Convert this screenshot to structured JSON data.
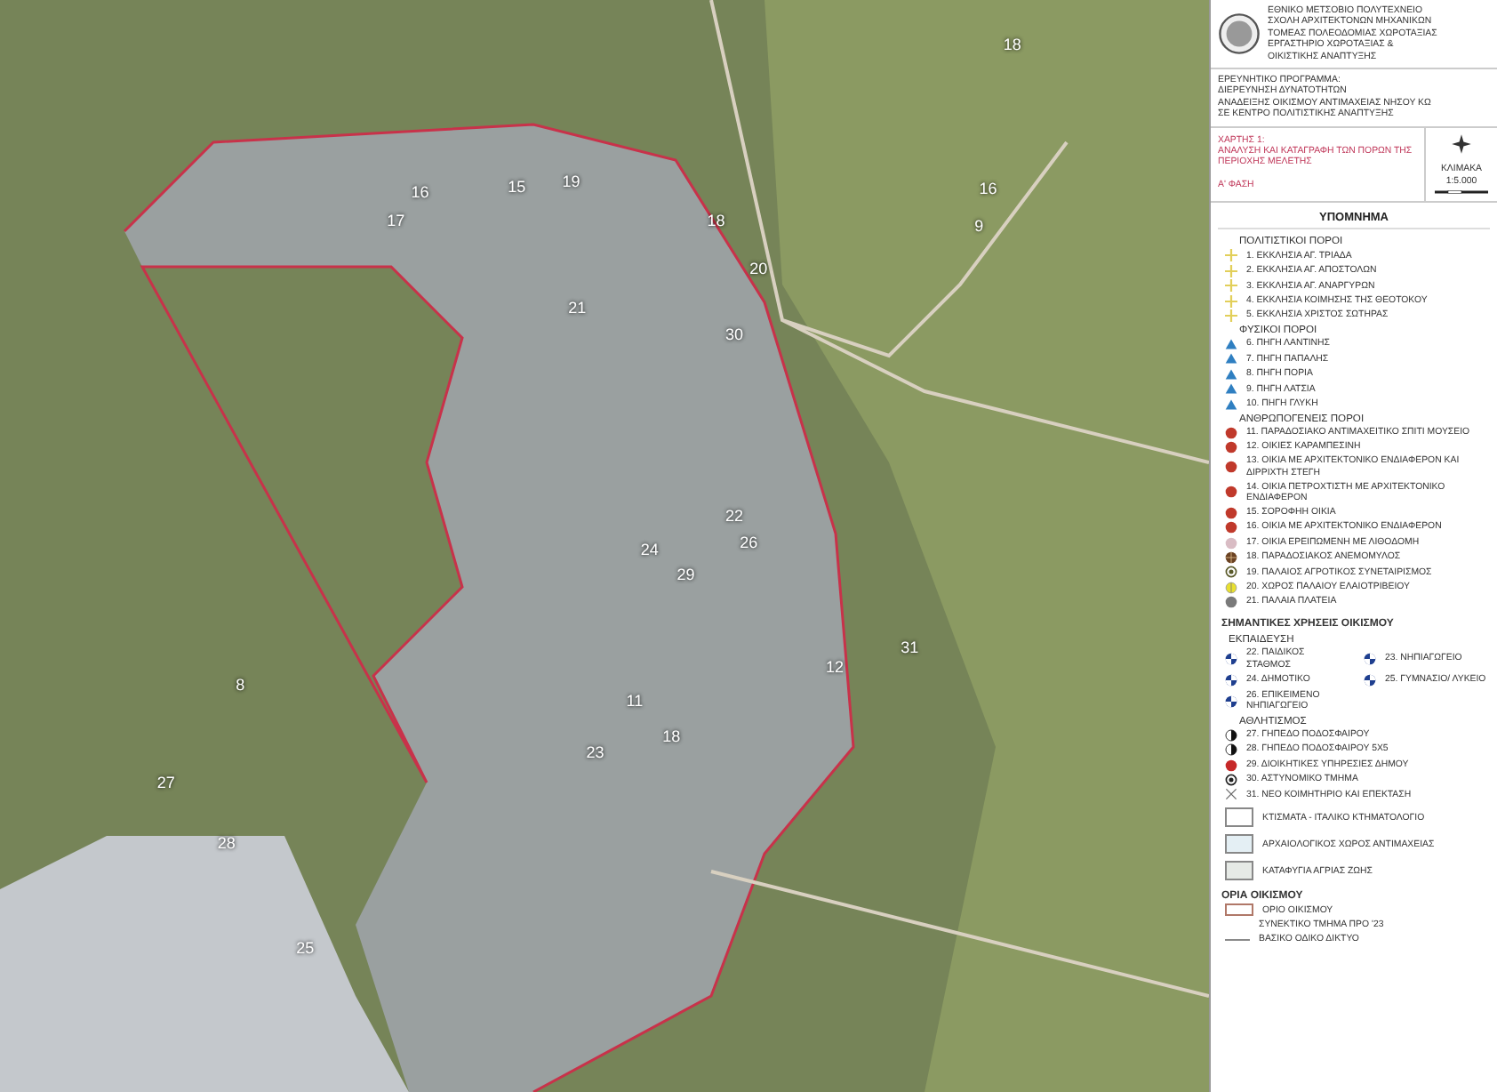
{
  "map": {
    "labels": [
      {
        "text": "16"
      },
      {
        "text": "17"
      },
      {
        "text": "15"
      },
      {
        "text": "19"
      },
      {
        "text": "18"
      },
      {
        "text": "20"
      },
      {
        "text": "30"
      },
      {
        "text": "21"
      },
      {
        "text": "22"
      },
      {
        "text": "26"
      },
      {
        "text": "29"
      },
      {
        "text": "24"
      },
      {
        "text": "12"
      },
      {
        "text": "31"
      },
      {
        "text": "11"
      },
      {
        "text": "23"
      },
      {
        "text": "18"
      },
      {
        "text": "8"
      },
      {
        "text": "27"
      },
      {
        "text": "28"
      },
      {
        "text": "25"
      },
      {
        "text": "16"
      },
      {
        "text": "9"
      },
      {
        "text": "18"
      }
    ]
  },
  "header": {
    "institution": [
      "ΕΘΝΙΚΟ ΜΕΤΣΟΒΙΟ ΠΟΛΥΤΕΧΝΕΙΟ",
      "ΣΧΟΛΗ ΑΡΧΙΤΕΚΤΟΝΩΝ ΜΗΧΑΝΙΚΩΝ",
      "ΤΟΜΕΑΣ ΠΟΛΕΟΔΟΜΙΑΣ ΧΩΡΟΤΑΞΙΑΣ",
      "ΕΡΓΑΣΤΗΡΙΟ ΧΩΡΟΤΑΞΙΑΣ &",
      "ΟΙΚΙΣΤΙΚΗΣ ΑΝΑΠΤΥΞΗΣ"
    ],
    "program": [
      "ΕΡΕΥΝΗΤΙΚΟ ΠΡΟΓΡΑΜΜΑ:",
      "ΔΙΕΡΕΥΝΗΣΗ ΔΥΝΑΤΟΤΗΤΩΝ",
      "ΑΝΑΔΕΙΞΗΣ ΟΙΚΙΣΜΟΥ ΑΝΤΙΜΑΧΕΙΑΣ ΝΗΣΟΥ ΚΩ",
      "ΣΕ ΚΕΝΤΡΟ ΠΟΛΙΤΙΣΤΙΚΗΣ ΑΝΑΠΤΥΞΗΣ"
    ],
    "map_number": "ΧΑΡΤΗΣ 1:",
    "map_title": "ΑΝΑΛΥΣΗ ΚΑΙ ΚΑΤΑΓΡΑΦΗ ΤΩΝ ΠΟΡΩΝ ΤΗΣ ΠΕΡΙΟΧΗΣ ΜΕΛΕΤΗΣ",
    "phase": "Α' ΦΑΣΗ",
    "scale_label": "ΚΛΙΜΑΚΑ",
    "scale": "1:5.000"
  },
  "legend": {
    "title": "ΥΠΟΜΝΗΜΑ",
    "groups": [
      {
        "kind": "sub",
        "title": "ΠΟΛΙΤΙΣΤΙΚΟΙ ΠΟΡΟΙ",
        "items": [
          {
            "kind": "cross",
            "color": "#e2cf5a",
            "label": "1. ΕΚΚΛΗΣΙΑ ΑΓ. ΤΡΙΑΔΑ"
          },
          {
            "kind": "cross",
            "color": "#e2cf5a",
            "label": "2. ΕΚΚΛΗΣΙΑ ΑΓ. ΑΠΟΣΤΟΛΩΝ"
          },
          {
            "kind": "cross",
            "color": "#e2cf5a",
            "label": "3. ΕΚΚΛΗΣΙΑ ΑΓ. ΑΝΑΡΓΥΡΩΝ"
          },
          {
            "kind": "cross",
            "color": "#e2cf5a",
            "label": "4. ΕΚΚΛΗΣΙΑ ΚΟΙΜΗΣΗΣ ΤΗΣ ΘΕΟΤΟΚΟΥ"
          },
          {
            "kind": "cross",
            "color": "#e2cf5a",
            "label": "5. ΕΚΚΛΗΣΙΑ ΧΡΙΣΤΟΣ ΣΩΤΗΡΑΣ"
          }
        ]
      },
      {
        "kind": "sub",
        "title": "ΦΥΣΙΚΟΙ ΠΟΡΟΙ",
        "items": [
          {
            "kind": "triangle",
            "color": "#2f7fc1",
            "label": "6. ΠΗΓΗ ΛΑΝΤΙΝΗΣ"
          },
          {
            "kind": "triangle",
            "color": "#2f7fc1",
            "label": "7. ΠΗΓΗ ΠΑΠΑΛΗΣ"
          },
          {
            "kind": "triangle",
            "color": "#2f7fc1",
            "label": "8. ΠΗΓΗ ΠΟΡΙΑ"
          },
          {
            "kind": "triangle",
            "color": "#2f7fc1",
            "label": "9. ΠΗΓΗ ΛΑΤΣΙΑ"
          },
          {
            "kind": "triangle",
            "color": "#2f7fc1",
            "label": "10. ΠΗΓΗ ΓΛΥΚΗ"
          }
        ]
      },
      {
        "kind": "sub",
        "title": "ΑΝΘΡΩΠΟΓΕΝΕΙΣ ΠΟΡΟΙ",
        "items": [
          {
            "kind": "dot",
            "color": "#c0392b",
            "label": "11. ΠΑΡΑΔΟΣΙΑΚΟ ΑΝΤΙΜΑΧΕΙΤΙΚΟ ΣΠΙΤΙ ΜΟΥΣΕΙΟ"
          },
          {
            "kind": "dot",
            "color": "#c0392b",
            "label": "12. ΟΙΚΙΕΣ ΚΑΡΑΜΠΕΣΙΝΗ"
          },
          {
            "kind": "dot",
            "color": "#c0392b",
            "label": "13. ΟΙΚΙΑ ΜΕ ΑΡΧΙΤΕΚΤΟΝΙΚΟ ΕΝΔΙΑΦΕΡΟΝ ΚΑΙ ΔΙΡΡΙΧΤΗ ΣΤΕΓΗ"
          },
          {
            "kind": "dot",
            "color": "#c0392b",
            "label": "14. ΟΙΚΙΑ ΠΕΤΡΟΧΤΙΣΤΗ ΜΕ ΑΡΧΙΤΕΚΤΟΝΙΚΟ ΕΝΔΙΑΦΕΡΟΝ"
          },
          {
            "kind": "dot",
            "color": "#c0392b",
            "label": "15. ΣΟΡΟΦΗΗ ΟΙΚΙΑ"
          },
          {
            "kind": "dot",
            "color": "#c0392b",
            "label": "16. ΟΙΚΙΑ ΜΕ ΑΡΧΙΤΕΚΤΟΝΙΚΟ ΕΝΔΙΑΦΕΡΟΝ"
          },
          {
            "kind": "dot",
            "color": "#d9bcc4",
            "label": "17. ΟΙΚΙΑ ΕΡΕΙΠΩΜΕΝΗ ΜΕ ΛΙΘΟΔΟΜΗ"
          },
          {
            "kind": "grid",
            "color": "#6b4222",
            "label": "18. ΠΑΡΑΔΟΣΙΑΚΟΣ ΑΝΕΜΟΜΥΛΟΣ"
          },
          {
            "kind": "target",
            "color": "#5a5a2a",
            "label": "19. ΠΑΛΑΙΟΣ ΑΓΡΟΤΙΚΟΣ ΣΥΝΕΤΑΙΡΙΣΜΟΣ"
          },
          {
            "kind": "ring",
            "color": "#e8e030",
            "label": "20. ΧΩΡΟΣ ΠΑΛΑΙΟΥ ΕΛΑΙΟΤΡΙΒΕΙΟΥ"
          },
          {
            "kind": "dot",
            "color": "#7a7a7a",
            "label": "21. ΠΑΛΑΙΑ ΠΛΑΤΕΙΑ"
          }
        ]
      },
      {
        "kind": "main",
        "title": "ΣΗΜΑΝΤΙΚΕΣ ΧΡΗΣΕΙΣ ΟΙΚΙΣΜΟΥ"
      },
      {
        "kind": "sub2",
        "title": "ΕΚΠΑΙΔΕΥΣΗ",
        "items": [
          {
            "kind": "school",
            "color": "#1f3f8f",
            "label": "22. ΠΑΙΔΙΚΟΣ ΣΤΑΘΜΟΣ"
          },
          {
            "kind": "school",
            "color": "#1f3f8f",
            "label": "23. ΝΗΠΙΑΓΩΓΕΙΟ"
          },
          {
            "kind": "school",
            "color": "#1f3f8f",
            "label": "24. ΔΗΜΟΤΙΚΟ"
          },
          {
            "kind": "school",
            "color": "#1f3f8f",
            "label": "25. ΓΥΜΝΑΣΙΟ/ ΛΥΚΕΙΟ"
          },
          {
            "kind": "school",
            "color": "#1f3f8f",
            "label": "26. ΕΠΙΚΕΙΜΕΝΟ ΝΗΠΙΑΓΩΓΕΙΟ"
          }
        ]
      },
      {
        "kind": "sub",
        "title": "ΑΘΛΗΤΙΣΜΟΣ",
        "items": [
          {
            "kind": "half",
            "color": "#111111",
            "label": "27. ΓΗΠΕΔΟ ΠΟΔΟΣΦΑΙΡΟΥ"
          },
          {
            "kind": "half",
            "color": "#111111",
            "label": "28. ΓΗΠΕΔΟ ΠΟΔΟΣΦΑΙΡΟΥ 5Χ5"
          },
          {
            "kind": "dot",
            "color": "#c62828",
            "label": "29. ΔΙΟΙΚΗΤΙΚΕΣ ΥΠΗΡΕΣΙΕΣ ΔΗΜΟΥ"
          },
          {
            "kind": "target",
            "color": "#222222",
            "label": "30. ΑΣΤΥΝΟΜΙΚΟ ΤΜΗΜΑ"
          },
          {
            "kind": "x",
            "color": "#666666",
            "label": "31. ΝΕΟ ΚΟΙΜΗΤΗΡΙΟ ΚΑΙ ΕΠΕΚΤΑΣΗ"
          }
        ]
      },
      {
        "kind": "plain",
        "items": [
          {
            "kind": "swatch",
            "color": "#ffffff",
            "label": "ΚΤΙΣΜΑΤΑ - ΙΤΑΛΙΚΟ ΚΤΗΜΑΤΟΛΟΓΙΟ"
          },
          {
            "kind": "swatch",
            "color": "#e4eff4",
            "label": "ΑΡΧΑΙΟΛΟΓΙΚΟΣ ΧΩΡΟΣ ΑΝΤΙΜΑΧΕΙΑΣ"
          },
          {
            "kind": "swatch",
            "color": "#e6eae6",
            "label": "ΚΑΤΑΦΥΓΙΑ ΑΓΡΙΑΣ ΖΩΗΣ"
          }
        ]
      },
      {
        "kind": "main",
        "title": "ΟΡΙΑ ΟΙΚΙΣΜΟΥ",
        "items": [
          {
            "kind": "outline",
            "color": "#b07868",
            "label": "ΟΡΙΟ ΟΙΚΙΣΜΟΥ"
          },
          {
            "kind": "text",
            "label": "ΣΥΝΕΚΤΙΚΟ ΤΜΗΜΑ ΠΡΟ '23"
          },
          {
            "kind": "line",
            "color": "#8a8a8a",
            "label": "ΒΑΣΙΚΟ ΟΔΙΚΟ ΔΙΚΤΥΟ"
          }
        ]
      }
    ]
  }
}
